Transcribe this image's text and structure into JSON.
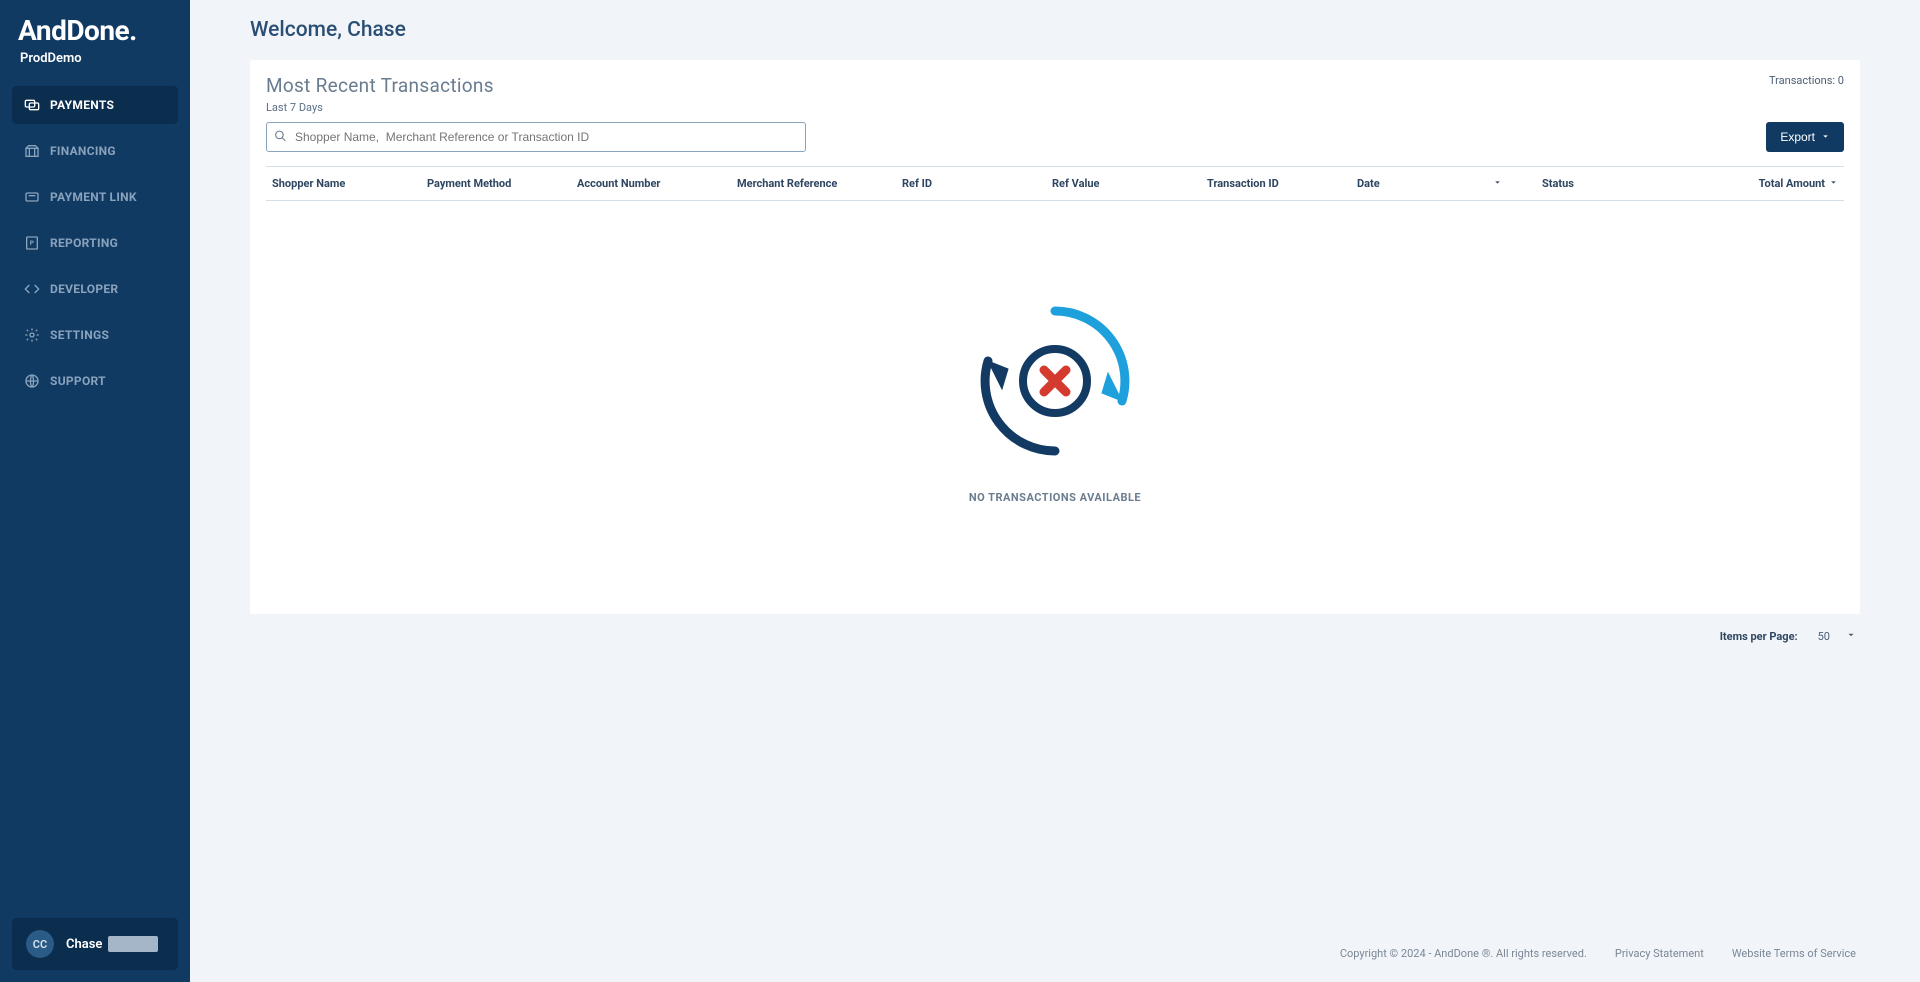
{
  "brand": {
    "logo_text": "AndDone.",
    "tenant": "ProdDemo"
  },
  "sidebar": {
    "items": [
      {
        "label": "PAYMENTS",
        "icon": "payments-icon",
        "active": true
      },
      {
        "label": "FINANCING",
        "icon": "financing-icon",
        "active": false
      },
      {
        "label": "PAYMENT LINK",
        "icon": "link-icon",
        "active": false
      },
      {
        "label": "REPORTING",
        "icon": "reporting-icon",
        "active": false
      },
      {
        "label": "DEVELOPER",
        "icon": "developer-icon",
        "active": false
      },
      {
        "label": "SETTINGS",
        "icon": "settings-icon",
        "active": false
      },
      {
        "label": "SUPPORT",
        "icon": "support-icon",
        "active": false
      }
    ]
  },
  "user": {
    "initials": "CC",
    "name": "Chase"
  },
  "page": {
    "title": "Welcome, Chase"
  },
  "transactions_card": {
    "title": "Most Recent Transactions",
    "subtitle": "Last 7 Days",
    "count_label": "Transactions: 0",
    "search_placeholder": "Shopper Name,  Merchant Reference or Transaction ID",
    "export_label": "Export",
    "columns": {
      "shopper": "Shopper Name",
      "pm": "Payment Method",
      "acct": "Account Number",
      "mref": "Merchant Reference",
      "refid": "Ref ID",
      "refval": "Ref Value",
      "txid": "Transaction ID",
      "date": "Date",
      "status": "Status",
      "total": "Total Amount"
    },
    "empty_text": "NO TRANSACTIONS AVAILABLE"
  },
  "pager": {
    "label": "Items per Page:",
    "value": "50"
  },
  "footer": {
    "copyright": "Copyright © 2024 - AndDone ®. All rights reserved.",
    "privacy": "Privacy Statement",
    "terms": "Website Terms of Service"
  }
}
